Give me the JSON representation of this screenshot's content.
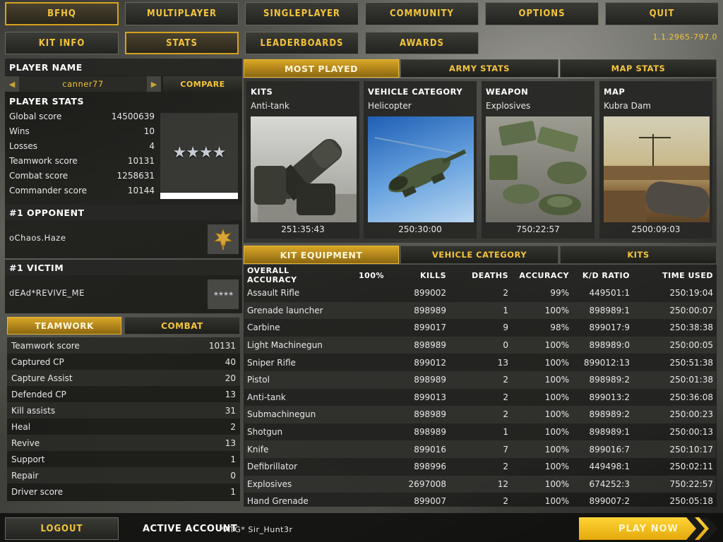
{
  "top_nav": [
    "BFHQ",
    "MULTIPLAYER",
    "SINGLEPLAYER",
    "COMMUNITY",
    "OPTIONS",
    "QUIT"
  ],
  "sub_nav": [
    "KIT INFO",
    "STATS",
    "LEADERBOARDS",
    "AWARDS"
  ],
  "version": "1.1.2965-797.0",
  "player": {
    "header": "PLAYER NAME",
    "name": "canner77",
    "compare": "COMPARE",
    "stats_header": "PLAYER STATS",
    "stats": [
      {
        "label": "Global score",
        "value": "14500639"
      },
      {
        "label": "Wins",
        "value": "10"
      },
      {
        "label": "Losses",
        "value": "4"
      },
      {
        "label": "Teamwork score",
        "value": "10131"
      },
      {
        "label": "Combat score",
        "value": "1258631"
      },
      {
        "label": "Commander score",
        "value": "10144"
      }
    ],
    "rank_stars": "★★★★"
  },
  "opponent": {
    "header": "#1 OPPONENT",
    "name": "oChaos.Haze"
  },
  "victim": {
    "header": "#1 VICTIM",
    "name": "dEAd*REVIVE_ME",
    "rank_stars": "★★★★"
  },
  "tw_tabs": [
    "TEAMWORK",
    "COMBAT"
  ],
  "teamwork": [
    {
      "label": "Teamwork score",
      "value": "10131"
    },
    {
      "label": "Captured CP",
      "value": "40"
    },
    {
      "label": "Capture Assist",
      "value": "20"
    },
    {
      "label": "Defended CP",
      "value": "13"
    },
    {
      "label": "Kill assists",
      "value": "31"
    },
    {
      "label": "Heal",
      "value": "2"
    },
    {
      "label": "Revive",
      "value": "13"
    },
    {
      "label": "Support",
      "value": "1"
    },
    {
      "label": "Repair",
      "value": "0"
    },
    {
      "label": "Driver score",
      "value": "1"
    }
  ],
  "most_played_tabs": [
    "MOST PLAYED",
    "ARMY STATS",
    "MAP STATS"
  ],
  "cards": [
    {
      "title": "KITS",
      "value": "Anti-tank",
      "time": "251:35:43",
      "icon": "anti-tank-launcher-image"
    },
    {
      "title": "VEHICLE CATEGORY",
      "value": "Helicopter",
      "time": "250:30:00",
      "icon": "helicopter-image"
    },
    {
      "title": "WEAPON",
      "value": "Explosives",
      "time": "750:22:57",
      "icon": "explosives-image"
    },
    {
      "title": "MAP",
      "value": "Kubra Dam",
      "time": "2500:09:03",
      "icon": "kubra-dam-map-image"
    }
  ],
  "kit_tabs": [
    "KIT EQUIPMENT",
    "VEHICLE CATEGORY",
    "KITS"
  ],
  "table": {
    "headers": [
      "OVERALL ACCURACY",
      "100%",
      "KILLS",
      "DEATHS",
      "ACCURACY",
      "K/D RATIO",
      "TIME USED"
    ],
    "rows": [
      [
        "Assault Rifle",
        "",
        "899002",
        "2",
        "99%",
        "449501:1",
        "250:19:04"
      ],
      [
        "Grenade launcher",
        "",
        "898989",
        "1",
        "100%",
        "898989:1",
        "250:00:07"
      ],
      [
        "Carbine",
        "",
        "899017",
        "9",
        "98%",
        "899017:9",
        "250:38:38"
      ],
      [
        "Light Machinegun",
        "",
        "898989",
        "0",
        "100%",
        "898989:0",
        "250:00:05"
      ],
      [
        "Sniper Rifle",
        "",
        "899012",
        "13",
        "100%",
        "899012:13",
        "250:51:38"
      ],
      [
        "Pistol",
        "",
        "898989",
        "2",
        "100%",
        "898989:2",
        "250:01:38"
      ],
      [
        "Anti-tank",
        "",
        "899013",
        "2",
        "100%",
        "899013:2",
        "250:36:08"
      ],
      [
        "Submachinegun",
        "",
        "898989",
        "2",
        "100%",
        "898989:2",
        "250:00:23"
      ],
      [
        "Shotgun",
        "",
        "898989",
        "1",
        "100%",
        "898989:1",
        "250:00:13"
      ],
      [
        "Knife",
        "",
        "899016",
        "7",
        "100%",
        "899016:7",
        "250:10:17"
      ],
      [
        "Defibrillator",
        "",
        "898996",
        "2",
        "100%",
        "449498:1",
        "250:02:11"
      ],
      [
        "Explosives",
        "",
        "2697008",
        "12",
        "100%",
        "674252:3",
        "750:22:57"
      ],
      [
        "Hand Grenade",
        "",
        "899007",
        "2",
        "100%",
        "899007:2",
        "250:05:18"
      ]
    ]
  },
  "footer": {
    "logout": "LOGOUT",
    "account_label": "ACTIVE ACCOUNT",
    "account_name": "*ATG* Sir_Hunt3r",
    "play_now": "PLAY NOW"
  },
  "colors": {
    "accent": "#f2c43b",
    "active_border": "#d6a21c"
  }
}
